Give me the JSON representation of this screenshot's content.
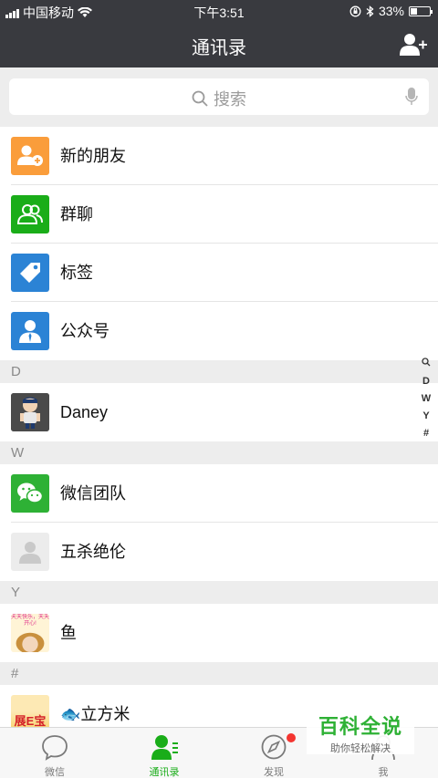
{
  "status_bar": {
    "carrier": "中国移动",
    "time": "下午3:51",
    "battery_percent": "33%",
    "battery_level": 0.33
  },
  "nav": {
    "title": "通讯录"
  },
  "search": {
    "placeholder": "搜索"
  },
  "fixed_items": [
    {
      "label": "新的朋友",
      "icon": "add-friend-icon",
      "color": "#fa9d3b"
    },
    {
      "label": "群聊",
      "icon": "group-chat-icon",
      "color": "#1aad19"
    },
    {
      "label": "标签",
      "icon": "tag-icon",
      "color": "#2b83d5"
    },
    {
      "label": "公众号",
      "icon": "official-account-icon",
      "color": "#2b83d5"
    }
  ],
  "sections": [
    {
      "letter": "D",
      "contacts": [
        "Daney"
      ]
    },
    {
      "letter": "W",
      "contacts": [
        "微信团队",
        "五杀绝伦"
      ]
    },
    {
      "letter": "Y",
      "contacts": [
        "鱼"
      ]
    },
    {
      "letter": "#",
      "contacts": [
        "🐟立方米"
      ]
    }
  ],
  "index_bar": [
    "D",
    "W",
    "Y",
    "#"
  ],
  "tabs": [
    {
      "label": "微信",
      "icon": "chat-bubble-icon"
    },
    {
      "label": "通讯录",
      "icon": "contacts-icon",
      "active": true
    },
    {
      "label": "发现",
      "icon": "compass-icon",
      "badge": true
    },
    {
      "label": "我",
      "icon": "me-icon"
    }
  ],
  "watermark": {
    "title": "百科全说",
    "subtitle": "助你轻松解决",
    "avatar_text": "展E宝",
    "avatar_caption": "天天快乐，天天开心!"
  },
  "colors": {
    "nav_bg": "#393a3f",
    "accent_green": "#1aad19",
    "badge_red": "#f43530"
  }
}
